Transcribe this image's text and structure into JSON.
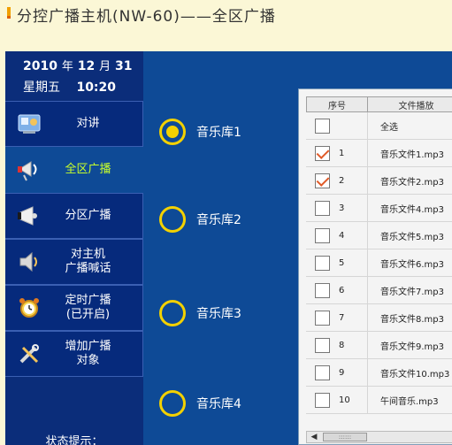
{
  "title": "分控广播主机(NW-60)——全区广播",
  "datetime": {
    "year": "2010",
    "year_unit": "年",
    "month": "12",
    "month_unit": "月",
    "day": "31",
    "weekday": "星期五",
    "time": "10:20"
  },
  "nav": [
    {
      "label": "对讲",
      "icon": "intercom-icon",
      "active": false
    },
    {
      "label": "全区广播",
      "icon": "megaphone-icon",
      "active": true
    },
    {
      "label": "分区广播",
      "icon": "loudspeaker-icon",
      "active": false
    },
    {
      "label_line1": "对主机",
      "label_line2": "广播喊话",
      "icon": "speaker-icon",
      "active": false
    },
    {
      "label_line1": "定时广播",
      "label_line2": "(已开启)",
      "icon": "alarm-clock-icon",
      "active": false
    },
    {
      "label_line1": "增加广播",
      "label_line2": "对象",
      "icon": "tools-icon",
      "active": false
    }
  ],
  "status_hint": "状态提示：",
  "libraries": [
    {
      "label": "音乐库1",
      "selected": true
    },
    {
      "label": "音乐库2",
      "selected": false
    },
    {
      "label": "音乐库3",
      "selected": false
    },
    {
      "label": "音乐库4",
      "selected": false
    }
  ],
  "table": {
    "headers": {
      "index": "序号",
      "file": "文件播放"
    },
    "rows": [
      {
        "index": "",
        "file": "全选",
        "checked": false
      },
      {
        "index": "1",
        "file": "音乐文件1.mp3",
        "checked": true
      },
      {
        "index": "2",
        "file": "音乐文件2.mp3",
        "checked": true
      },
      {
        "index": "3",
        "file": "音乐文件4.mp3",
        "checked": false
      },
      {
        "index": "4",
        "file": "音乐文件5.mp3",
        "checked": false
      },
      {
        "index": "5",
        "file": "音乐文件6.mp3",
        "checked": false
      },
      {
        "index": "6",
        "file": "音乐文件7.mp3",
        "checked": false
      },
      {
        "index": "7",
        "file": "音乐文件8.mp3",
        "checked": false
      },
      {
        "index": "8",
        "file": "音乐文件9.mp3",
        "checked": false
      },
      {
        "index": "9",
        "file": "音乐文件10.mp3",
        "checked": false
      },
      {
        "index": "10",
        "file": "午间音乐.mp3",
        "checked": false
      }
    ]
  },
  "colors": {
    "screen_bg": "#0e4a96",
    "sidebar_bg": "#0b2d7a",
    "active_text": "#c8ff2a",
    "radio": "#f3d100",
    "check": "#e05a28"
  }
}
